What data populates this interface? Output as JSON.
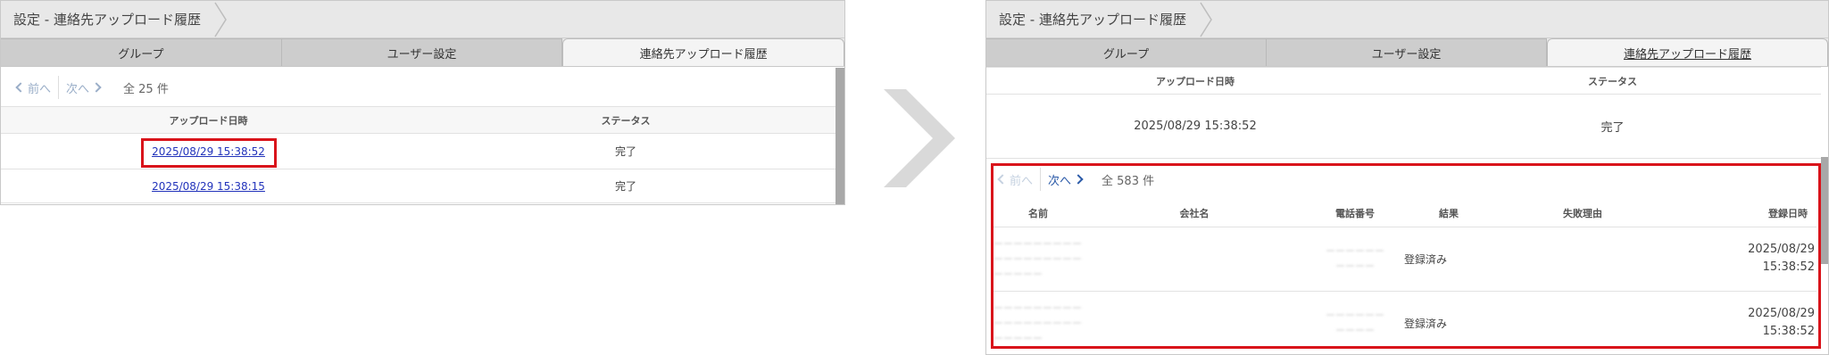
{
  "left": {
    "breadcrumb": "設定 - 連絡先アップロード履歴",
    "tabs": [
      "グループ",
      "ユーザー設定",
      "連絡先アップロード履歴"
    ],
    "pager": {
      "prev": "前へ",
      "next": "次へ",
      "total": "全 25 件"
    },
    "table": {
      "headers": [
        "アップロード日時",
        "ステータス"
      ],
      "rows": [
        {
          "datetime": "2025/08/29 15:38:52",
          "status": "完了"
        },
        {
          "datetime": "2025/08/29 15:38:15",
          "status": "完了"
        }
      ]
    }
  },
  "right": {
    "breadcrumb": "設定 - 連絡先アップロード履歴",
    "tabs": [
      "グループ",
      "ユーザー設定",
      "連絡先アップロード履歴"
    ],
    "upload_table": {
      "headers": [
        "アップロード日時",
        "ステータス"
      ],
      "row": {
        "datetime": "2025/08/29 15:38:52",
        "status": "完了"
      }
    },
    "pager": {
      "prev": "前へ",
      "next": "次へ",
      "total": "全 583 件"
    },
    "detail_table": {
      "headers": [
        "名前",
        "会社名",
        "電話番号",
        "結果",
        "失敗理由",
        "登録日時"
      ],
      "rows": [
        {
          "result": "登録済み",
          "registered_date": "2025/08/29",
          "registered_time": "15:38:52"
        },
        {
          "result": "登録済み",
          "registered_date": "2025/08/29",
          "registered_time": "15:38:52"
        }
      ]
    }
  },
  "colors": {
    "highlight": "#d9141b",
    "link": "#2233bb",
    "chevron": "#d9d9d9"
  },
  "icons": [
    "chevron-left-icon",
    "chevron-right-icon",
    "sort-icon",
    "big-arrow-icon"
  ]
}
